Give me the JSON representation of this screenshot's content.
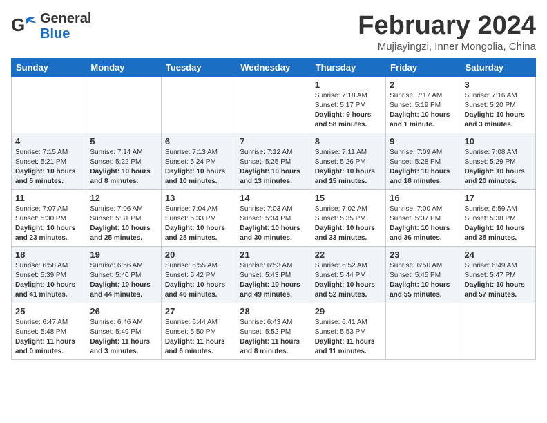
{
  "header": {
    "logo_line1": "General",
    "logo_line2": "Blue",
    "title": "February 2024",
    "subtitle": "Mujiayingzi, Inner Mongolia, China"
  },
  "weekdays": [
    "Sunday",
    "Monday",
    "Tuesday",
    "Wednesday",
    "Thursday",
    "Friday",
    "Saturday"
  ],
  "weeks": [
    [
      {
        "day": "",
        "info": ""
      },
      {
        "day": "",
        "info": ""
      },
      {
        "day": "",
        "info": ""
      },
      {
        "day": "",
        "info": ""
      },
      {
        "day": "1",
        "sunrise": "7:18 AM",
        "sunset": "5:17 PM",
        "daylight": "9 hours and 58 minutes."
      },
      {
        "day": "2",
        "sunrise": "7:17 AM",
        "sunset": "5:19 PM",
        "daylight": "10 hours and 1 minute."
      },
      {
        "day": "3",
        "sunrise": "7:16 AM",
        "sunset": "5:20 PM",
        "daylight": "10 hours and 3 minutes."
      }
    ],
    [
      {
        "day": "4",
        "sunrise": "7:15 AM",
        "sunset": "5:21 PM",
        "daylight": "10 hours and 5 minutes."
      },
      {
        "day": "5",
        "sunrise": "7:14 AM",
        "sunset": "5:22 PM",
        "daylight": "10 hours and 8 minutes."
      },
      {
        "day": "6",
        "sunrise": "7:13 AM",
        "sunset": "5:24 PM",
        "daylight": "10 hours and 10 minutes."
      },
      {
        "day": "7",
        "sunrise": "7:12 AM",
        "sunset": "5:25 PM",
        "daylight": "10 hours and 13 minutes."
      },
      {
        "day": "8",
        "sunrise": "7:11 AM",
        "sunset": "5:26 PM",
        "daylight": "10 hours and 15 minutes."
      },
      {
        "day": "9",
        "sunrise": "7:09 AM",
        "sunset": "5:28 PM",
        "daylight": "10 hours and 18 minutes."
      },
      {
        "day": "10",
        "sunrise": "7:08 AM",
        "sunset": "5:29 PM",
        "daylight": "10 hours and 20 minutes."
      }
    ],
    [
      {
        "day": "11",
        "sunrise": "7:07 AM",
        "sunset": "5:30 PM",
        "daylight": "10 hours and 23 minutes."
      },
      {
        "day": "12",
        "sunrise": "7:06 AM",
        "sunset": "5:31 PM",
        "daylight": "10 hours and 25 minutes."
      },
      {
        "day": "13",
        "sunrise": "7:04 AM",
        "sunset": "5:33 PM",
        "daylight": "10 hours and 28 minutes."
      },
      {
        "day": "14",
        "sunrise": "7:03 AM",
        "sunset": "5:34 PM",
        "daylight": "10 hours and 30 minutes."
      },
      {
        "day": "15",
        "sunrise": "7:02 AM",
        "sunset": "5:35 PM",
        "daylight": "10 hours and 33 minutes."
      },
      {
        "day": "16",
        "sunrise": "7:00 AM",
        "sunset": "5:37 PM",
        "daylight": "10 hours and 36 minutes."
      },
      {
        "day": "17",
        "sunrise": "6:59 AM",
        "sunset": "5:38 PM",
        "daylight": "10 hours and 38 minutes."
      }
    ],
    [
      {
        "day": "18",
        "sunrise": "6:58 AM",
        "sunset": "5:39 PM",
        "daylight": "10 hours and 41 minutes."
      },
      {
        "day": "19",
        "sunrise": "6:56 AM",
        "sunset": "5:40 PM",
        "daylight": "10 hours and 44 minutes."
      },
      {
        "day": "20",
        "sunrise": "6:55 AM",
        "sunset": "5:42 PM",
        "daylight": "10 hours and 46 minutes."
      },
      {
        "day": "21",
        "sunrise": "6:53 AM",
        "sunset": "5:43 PM",
        "daylight": "10 hours and 49 minutes."
      },
      {
        "day": "22",
        "sunrise": "6:52 AM",
        "sunset": "5:44 PM",
        "daylight": "10 hours and 52 minutes."
      },
      {
        "day": "23",
        "sunrise": "6:50 AM",
        "sunset": "5:45 PM",
        "daylight": "10 hours and 55 minutes."
      },
      {
        "day": "24",
        "sunrise": "6:49 AM",
        "sunset": "5:47 PM",
        "daylight": "10 hours and 57 minutes."
      }
    ],
    [
      {
        "day": "25",
        "sunrise": "6:47 AM",
        "sunset": "5:48 PM",
        "daylight": "11 hours and 0 minutes."
      },
      {
        "day": "26",
        "sunrise": "6:46 AM",
        "sunset": "5:49 PM",
        "daylight": "11 hours and 3 minutes."
      },
      {
        "day": "27",
        "sunrise": "6:44 AM",
        "sunset": "5:50 PM",
        "daylight": "11 hours and 6 minutes."
      },
      {
        "day": "28",
        "sunrise": "6:43 AM",
        "sunset": "5:52 PM",
        "daylight": "11 hours and 8 minutes."
      },
      {
        "day": "29",
        "sunrise": "6:41 AM",
        "sunset": "5:53 PM",
        "daylight": "11 hours and 11 minutes."
      },
      {
        "day": "",
        "info": ""
      },
      {
        "day": "",
        "info": ""
      }
    ]
  ]
}
